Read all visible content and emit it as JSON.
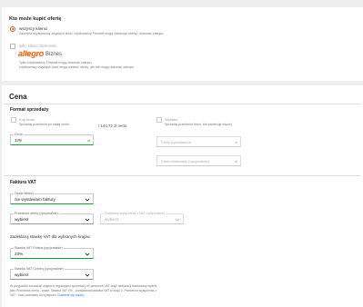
{
  "buyers": {
    "heading": "Kto może kupić ofertę",
    "option_all": {
      "label": "wszyscy klienci",
      "desc": "Zarówno użytkownicy zwykłych kont i użytkownicy Firmowi mogą zobaczyć ofertę i dokonać zakupu."
    },
    "option_business": {
      "label": "tylko klienci biznesowi",
      "desc1": "Tylko użytkownicy Firmowi mogą dokonać zakupu.",
      "desc2": "Użytkownicy zwykłych kont mogą widzieć ofertę, ale nie mogą dokonać zakupu."
    },
    "logo_text": "allegro",
    "logo_sub": "Biznes"
  },
  "price": {
    "heading": "Cena",
    "format_heading": "Format sprzedaży",
    "buy_now": {
      "label": "Kup teraz",
      "desc": "Sprzedaj przedmiot po stałej cenie."
    },
    "net_price": "/ 144,72 zł netto",
    "auction": {
      "label": "Wystaw",
      "desc": "Sprzedaj przedmiot temu, kto zaoferuje więcej."
    },
    "price_field": {
      "label": "Cena",
      "value": "178",
      "suffix": "zł"
    },
    "start_price_placeholder": "Cena wywoławcza",
    "min_price_placeholder": "Cena minimalna (opcjonalnie)",
    "currency": "zł"
  },
  "vat": {
    "heading": "Faktura VAT",
    "invoice_option": {
      "label": "Opcje faktury",
      "value": "nie wystawiam faktury"
    },
    "exemption": {
      "label": "Przedmiot oferty (opcjonalnie)",
      "value": "wybierz"
    },
    "exemption_basis": {
      "label": "Podstawa wyłączenia z VAT (opcjonalnie)",
      "value": "wybierz"
    },
    "declare_text": "Zadeklaruj stawkę VAT dla wybranych krajów.",
    "vat_pl": {
      "label": "Stawka VAT Polska (opcjonalnie)",
      "value": "23%"
    },
    "vat_cz": {
      "label": "Stawka VAT Czechy (opcjonalnie)",
      "value": "wybierz"
    },
    "note1": "W przypadku transakcji objętych regulacjami sprzedaży eCommerce VAT kraje deklaracji traktowany będzie",
    "note2": "jako Przedmiot oferty - towar. Stawka VAT 0% - podstawowa stawka VAT w kraju 0, Przedmiot wyłączenia z",
    "note3_a": "VAT - brak podstawy do wyłączeń.",
    "note3_link": "Dowiedz się więcej."
  },
  "colors": {
    "accent": "#e8541c",
    "valid": "#1a9b3a",
    "link": "#2c7be5"
  }
}
